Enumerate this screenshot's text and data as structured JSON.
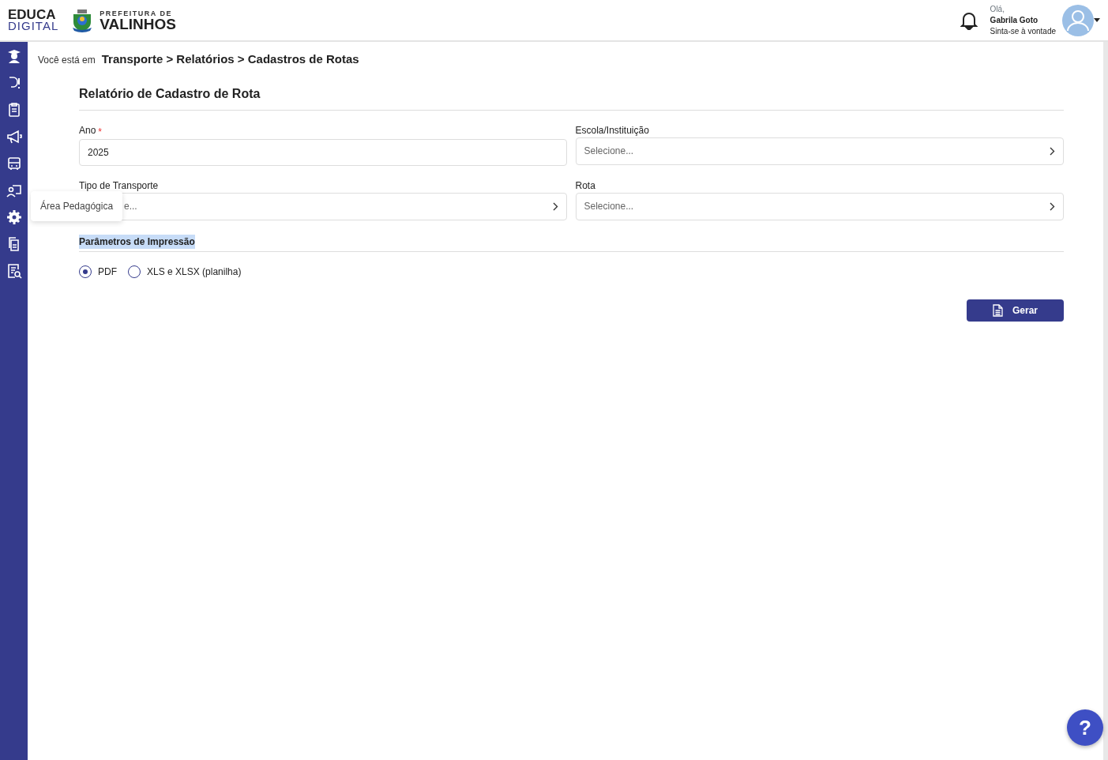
{
  "header": {
    "logo_top": "EDUCA",
    "logo_bottom": "DIGITAL",
    "city_top": "PREFEITURA DE",
    "city_name": "VALINHOS",
    "greeting": "Olá,",
    "user_name": "Gabrila Goto",
    "user_subtitle": "Sinta-se à vontade"
  },
  "sidebar": {
    "tooltip": "Área Pedagógica"
  },
  "breadcrumb": {
    "prefix": "Você está em",
    "path": "Transporte > Relatórios > Cadastros de Rotas"
  },
  "form": {
    "title": "Relatório de Cadastro de Rota",
    "fields": [
      {
        "label": "Ano",
        "required_mark": "*",
        "kind": "text",
        "value": "2025"
      },
      {
        "label": "Escola/Instituição",
        "kind": "select",
        "placeholder": "Selecione..."
      },
      {
        "label": "Tipo de Transporte",
        "kind": "select",
        "placeholder": "e...",
        "covered": true
      },
      {
        "label": "Rota",
        "kind": "select",
        "placeholder": "Selecione..."
      }
    ],
    "section": {
      "title": "Parâmetros de Impressão",
      "selected": true
    },
    "formats": [
      {
        "label": "PDF",
        "selected": true
      },
      {
        "label": "XLS e XLSX (planilha)",
        "selected": false
      }
    ],
    "submit": "Gerar"
  },
  "help_button": "?"
}
